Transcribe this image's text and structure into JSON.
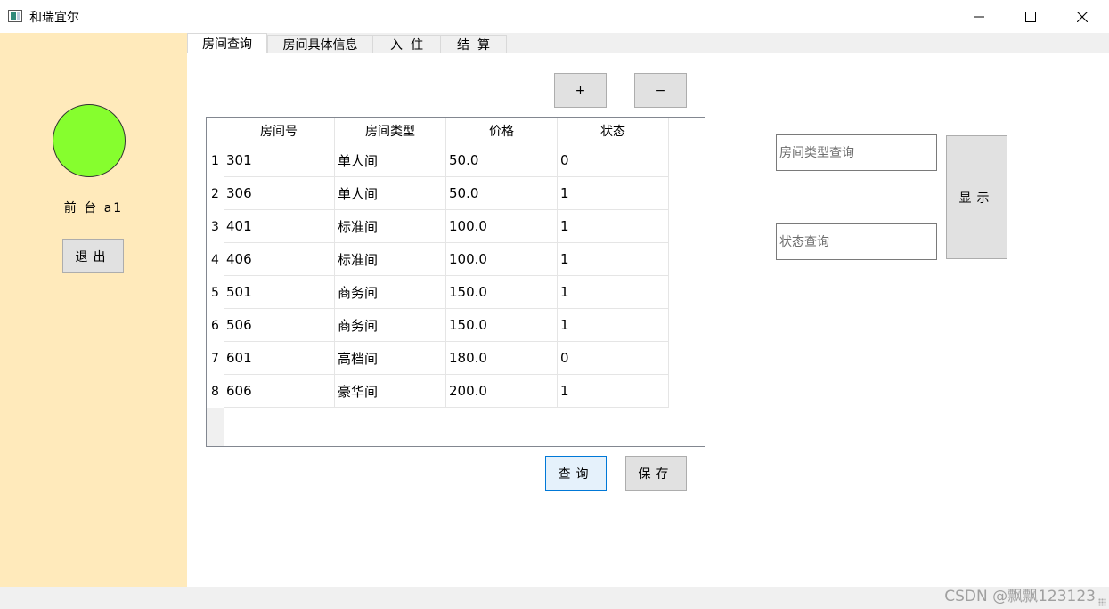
{
  "window": {
    "title": "和瑞宜尔",
    "icon": "app-window-icon",
    "controls": [
      "minimize-icon",
      "maximize-icon",
      "close-icon"
    ]
  },
  "sidebar": {
    "status_color": "#86fe2e",
    "user_label": "前 台 a1",
    "logout_label": "退出"
  },
  "tabs": [
    {
      "label": "房间查询",
      "active": true
    },
    {
      "label": "房间具体信息",
      "active": false
    },
    {
      "label": "入  住",
      "active": false
    },
    {
      "label": "结  算",
      "active": false
    }
  ],
  "toolbar": {
    "add_label": "+",
    "remove_label": "−"
  },
  "table": {
    "columns": [
      "房间号",
      "房间类型",
      "价格",
      "状态"
    ],
    "row_numbers": [
      "1",
      "2",
      "3",
      "4",
      "5",
      "6",
      "7",
      "8"
    ],
    "rows": [
      [
        "301",
        "单人间",
        "50.0",
        "0"
      ],
      [
        "306",
        "单人间",
        "50.0",
        "1"
      ],
      [
        "401",
        "标准间",
        "100.0",
        "1"
      ],
      [
        "406",
        "标准间",
        "100.0",
        "1"
      ],
      [
        "501",
        "商务间",
        "150.0",
        "1"
      ],
      [
        "506",
        "商务间",
        "150.0",
        "1"
      ],
      [
        "601",
        "高档间",
        "180.0",
        "0"
      ],
      [
        "606",
        "豪华间",
        "200.0",
        "1"
      ]
    ]
  },
  "actions": {
    "query_label": "查询",
    "save_label": "保存"
  },
  "filters": {
    "type_value": "",
    "type_placeholder": "房间类型查询",
    "status_value": "",
    "status_placeholder": "状态查询",
    "show_label": "显示"
  },
  "watermark": "CSDN @飘飘123123"
}
